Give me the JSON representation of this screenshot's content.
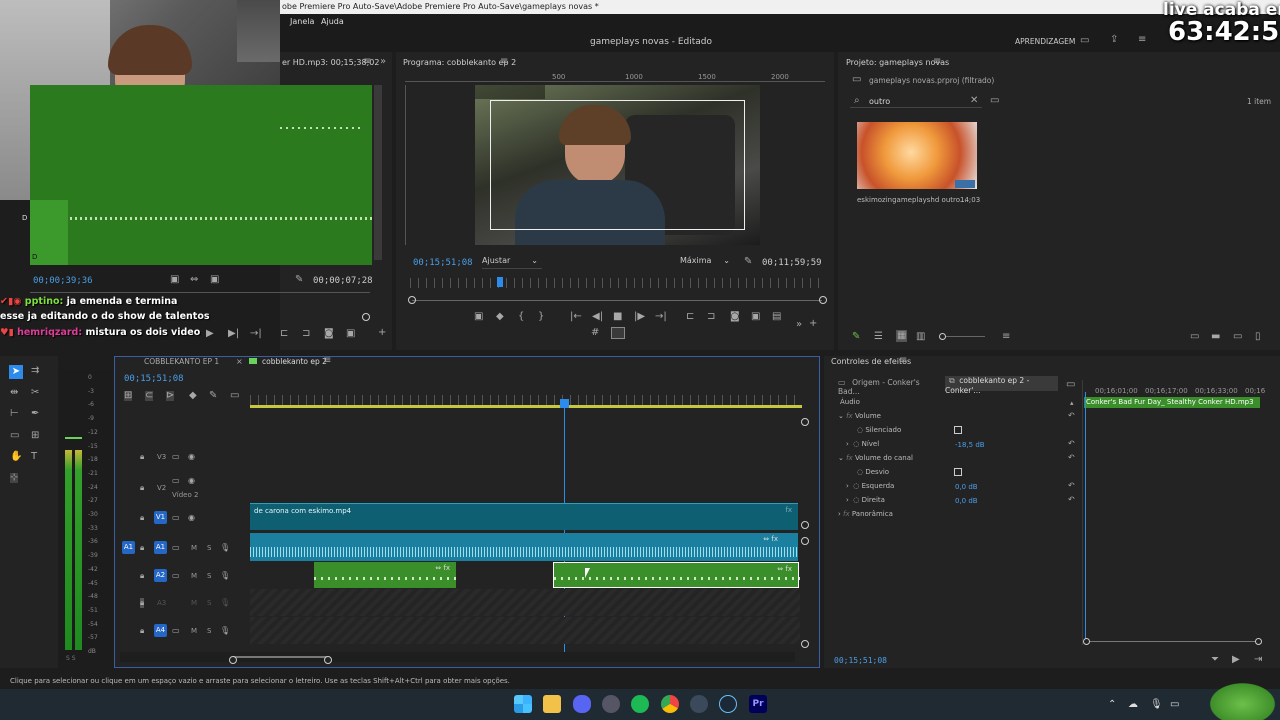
{
  "titlebar": {
    "title": "obe Premiere Pro Auto-Save\\Adobe Premiere Pro Auto-Save\\gameplays novas *"
  },
  "menu": {
    "items": [
      "Janela",
      "Ajuda"
    ]
  },
  "header": {
    "project_title": "gameplays novas - Editado",
    "workspace": "APRENDIZAGEM"
  },
  "overlay": {
    "live_label": "live acaba em:",
    "live_timer": "63:42:51"
  },
  "source": {
    "tab": "er HD.mp3: 00;15;38;02",
    "timecode": "00;00;39;36",
    "duration": "00;00;07;28",
    "marker": "D"
  },
  "program": {
    "tab": "Programa: cobblekanto ep 2",
    "ruler": [
      "500",
      "1000",
      "1500",
      "2000"
    ],
    "timecode": "00;15;51;08",
    "fit": "Ajustar",
    "quality": "Máxima",
    "duration": "00;11;59;59"
  },
  "project": {
    "tab": "Projeto: gameplays novas",
    "file": "gameplays novas.prproj (filtrado)",
    "search": "outro",
    "count": "1 item",
    "clip_name": "eskimozingameplayshd outro...",
    "clip_duration": "14;03"
  },
  "chat": [
    {
      "user": "pptino:",
      "msg": "ja emenda e termina"
    },
    {
      "user": "",
      "msg": "esse ja editando o do show de talentos"
    },
    {
      "user": "hemriqzard:",
      "msg": "mistura os dois video"
    }
  ],
  "timeline": {
    "tabs": [
      "COBBLEKANTO EP 1",
      "cobblekanto ep 2"
    ],
    "timecode": "00;15;51;08",
    "video2_label": "Vídeo 2",
    "clip_v1": "de carona com eskimo.mp4",
    "tracks": [
      {
        "id": "V3"
      },
      {
        "id": "V2"
      },
      {
        "id": "V1"
      },
      {
        "id": "A1"
      },
      {
        "id": "A2"
      },
      {
        "id": "A3"
      },
      {
        "id": "A4"
      }
    ],
    "meter_scale": [
      "0",
      "-3",
      "-6",
      "-9",
      "-12",
      "-15",
      "-18",
      "-21",
      "-24",
      "-27",
      "-30",
      "-33",
      "-36",
      "-39",
      "-42",
      "-45",
      "-48",
      "-51",
      "-54",
      "-57",
      "dB"
    ]
  },
  "effects": {
    "tab": "Controles de efeitos",
    "source_tab": "Origem - Conker's Bad...",
    "seq_tab": "cobblekanto ep 2 - Conker'...",
    "times": [
      "00;16;01;00",
      "00;16;17;00",
      "00;16;33;00",
      "00;16"
    ],
    "clip": "Conker's Bad Fur Day_ Stealthy Conker HD.mp3",
    "section": "Áudio",
    "rows": {
      "volume": "Volume",
      "silenced": "Silenciado",
      "level": "Nível",
      "level_val": "-18,5 dB",
      "channel": "Volume do canal",
      "bypass": "Desvio",
      "left": "Esquerda",
      "left_val": "0,0 dB",
      "right": "Direita",
      "right_val": "0,0 dB",
      "pan": "Panorâmica"
    },
    "timecode": "00;15;51;08"
  },
  "status": {
    "text": "Clique para selecionar ou clique em um espaço vazio e arraste para selecionar o letreiro. Use as teclas Shift+Alt+Ctrl para obter mais opções."
  },
  "colors": {
    "accent": "#2d8ceb",
    "audio_green": "#3a8f2a",
    "video_teal": "#0f5f73",
    "panel": "#232323"
  }
}
